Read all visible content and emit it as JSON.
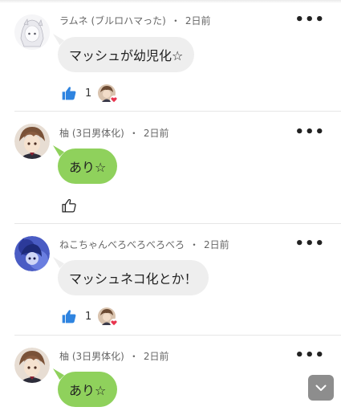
{
  "colors": {
    "bubble_gray": "#eeeeee",
    "bubble_green": "#8fd15c",
    "like_blue": "#2f84e0",
    "heart_red": "#e8344e"
  },
  "comments": [
    {
      "user": "ラムネ (ブルロハマった)",
      "separator": "・",
      "time": "2日前",
      "text": "マッシュが幼児化☆",
      "bubble": "gray",
      "likes": "1",
      "liked": true
    },
    {
      "user": "柚 (3日男体化)",
      "separator": "・",
      "time": "2日前",
      "text": "あり☆",
      "bubble": "green",
      "likes": null,
      "liked": false
    },
    {
      "user": "ねこちゃんべろべろべろべろ",
      "separator": "・",
      "time": "2日前",
      "text": "マッシュネコ化とか！",
      "bubble": "gray",
      "likes": "1",
      "liked": true
    },
    {
      "user": "柚 (3日男体化)",
      "separator": "・",
      "time": "2日前",
      "text": "あり☆",
      "bubble": "green",
      "likes": null,
      "liked": false
    }
  ],
  "more_icon": "more-dots-icon",
  "scroll_icon": "chevron-down-icon"
}
